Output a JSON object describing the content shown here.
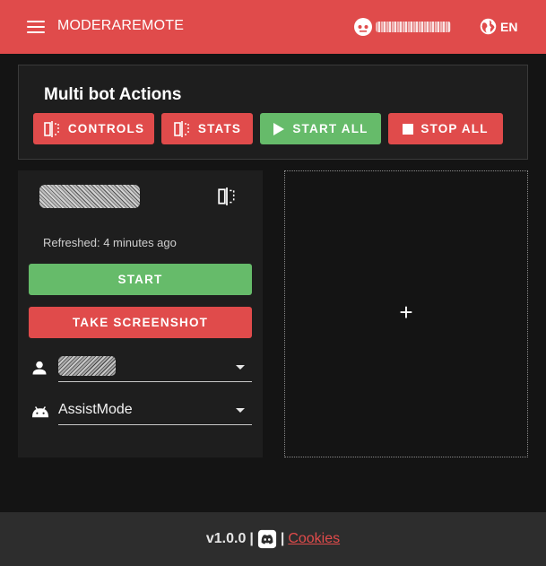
{
  "appbar": {
    "title": "MODERAREMOTE",
    "menu_icon": "hamburger-menu-icon",
    "user_icon": "robot-face-icon",
    "language": "EN",
    "language_icon": "globe-icon"
  },
  "multi_bot": {
    "title": "Multi bot Actions",
    "buttons": {
      "controls": "CONTROLS",
      "stats": "STATS",
      "start_all": "START ALL",
      "stop_all": "STOP ALL"
    }
  },
  "bot_card": {
    "refreshed": "Refreshed: 4 minutes ago",
    "start_label": "START",
    "screenshot_label": "TAKE SCREENSHOT",
    "mode_value": "AssistMode",
    "user_icon": "person-icon",
    "mode_icon": "android-icon"
  },
  "add_card": {
    "plus": "+"
  },
  "footer": {
    "version": "v1.0.0",
    "separator": "|",
    "cookies": "Cookies",
    "discord_icon": "discord-icon"
  },
  "colors": {
    "primary": "#e04b4b",
    "success": "#66bb6a",
    "background": "#141414",
    "card": "#1e1e1e",
    "footer": "#2d2d2d"
  }
}
